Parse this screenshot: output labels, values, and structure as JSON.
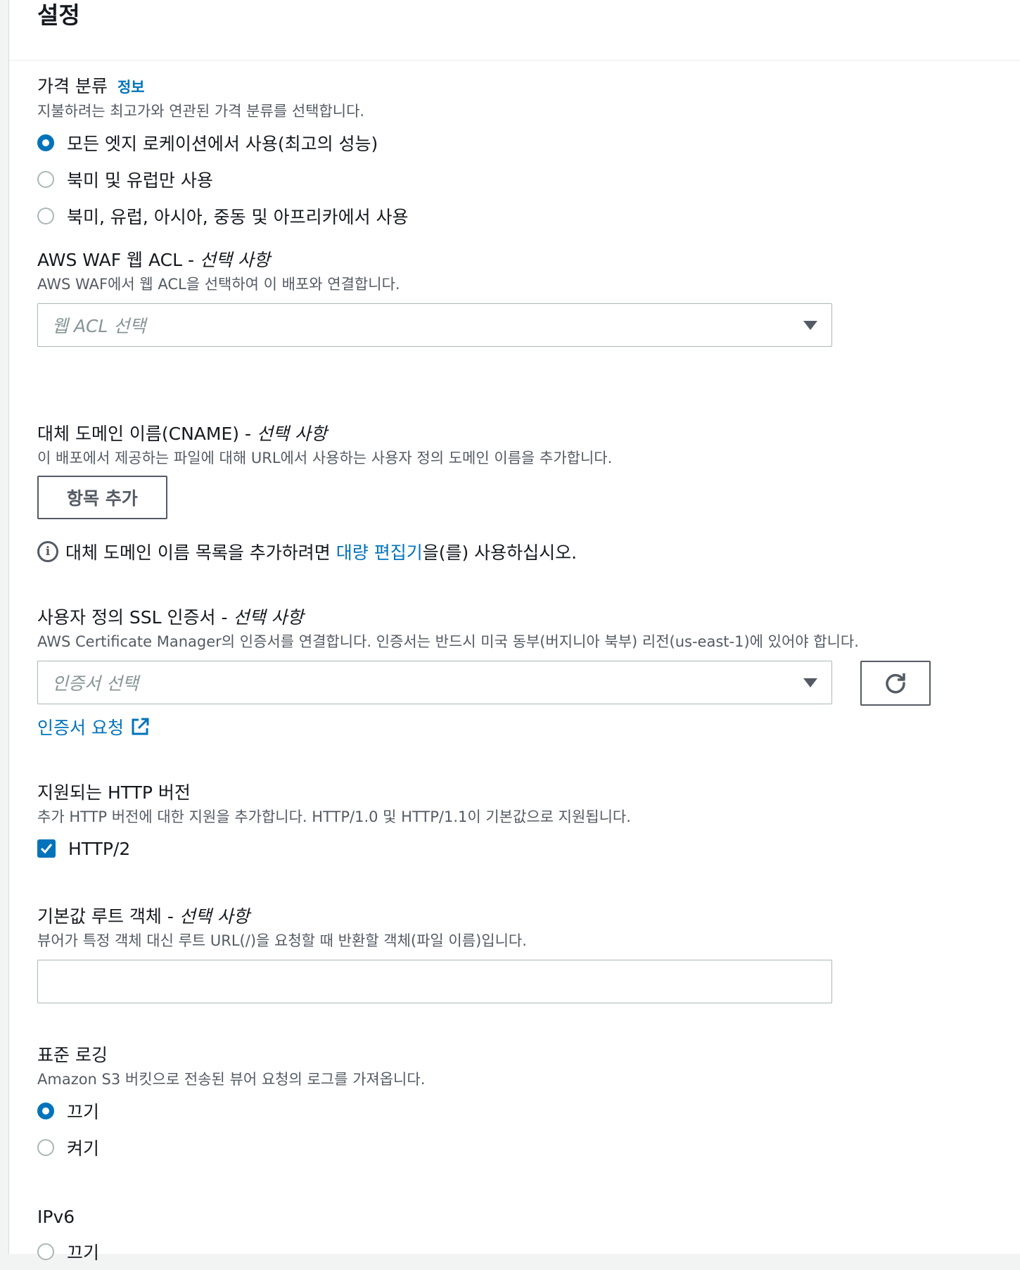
{
  "header": {
    "title": "설정"
  },
  "price_class": {
    "label": "가격 분류",
    "info_link": "정보",
    "description": "지불하려는 최고가와 연관된 가격 분류를 선택합니다.",
    "options": [
      {
        "label": "모든 엣지 로케이션에서 사용(최고의 성능)",
        "selected": true
      },
      {
        "label": "북미 및 유럽만 사용",
        "selected": false
      },
      {
        "label": "북미, 유럽, 아시아, 중동 및 아프리카에서 사용",
        "selected": false
      }
    ]
  },
  "waf": {
    "label": "AWS WAF 웹 ACL - ",
    "optional": "선택 사항",
    "description": "AWS WAF에서 웹 ACL을 선택하여 이 배포와 연결합니다.",
    "placeholder": "웹 ACL 선택"
  },
  "cname": {
    "label": "대체 도메인 이름(CNAME) - ",
    "optional": "선택 사항",
    "description": "이 배포에서 제공하는 파일에 대해 URL에서 사용하는 사용자 정의 도메인 이름을 추가합니다.",
    "add_button": "항목 추가",
    "note_before": "대체 도메인 이름 목록을 추가하려면 ",
    "note_link": "대량 편집기",
    "note_after": "을(를) 사용하십시오."
  },
  "ssl": {
    "label": "사용자 정의 SSL 인증서 - ",
    "optional": "선택 사항",
    "description": "AWS Certificate Manager의 인증서를 연결합니다. 인증서는 반드시 미국 동부(버지니아 북부) 리전(us-east-1)에 있어야 합니다.",
    "placeholder": "인증서 선택",
    "request_link": "인증서 요청"
  },
  "http": {
    "label": "지원되는 HTTP 버전",
    "description": "추가 HTTP 버전에 대한 지원을 추가합니다. HTTP/1.0 및 HTTP/1.1이 기본값으로 지원됩니다.",
    "option": "HTTP/2",
    "checked": true
  },
  "root_object": {
    "label": "기본값 루트 객체 - ",
    "optional": "선택 사항",
    "description": "뷰어가 특정 객체 대신 루트 URL(/)을 요청할 때 반환할 객체(파일 이름)입니다.",
    "value": ""
  },
  "logging": {
    "label": "표준 로깅",
    "description": "Amazon S3 버킷으로 전송된 뷰어 요청의 로그를 가져옵니다.",
    "options": [
      {
        "label": "끄기",
        "selected": true
      },
      {
        "label": "켜기",
        "selected": false
      }
    ]
  },
  "ipv6": {
    "label": "IPv6",
    "options": [
      {
        "label": "끄기",
        "selected": false
      }
    ]
  }
}
